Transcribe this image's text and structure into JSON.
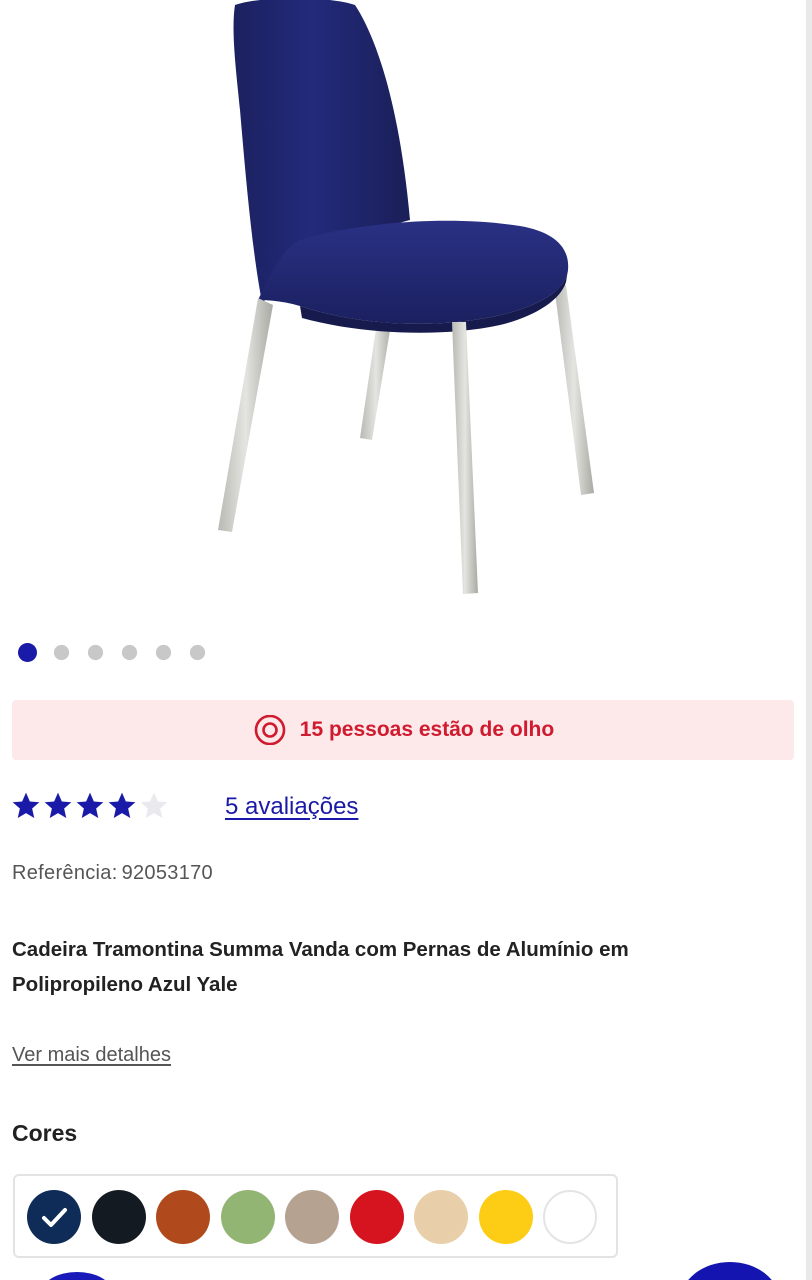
{
  "product": {
    "image_alt": "chair-photo",
    "carousel": {
      "total": 6,
      "active_index": 0
    },
    "watching_text": "15 pessoas estão de olho",
    "rating": {
      "value": 4,
      "max": 5,
      "reviews_label": "5 avaliações"
    },
    "reference_label": "Referência:",
    "reference_number": "92053170",
    "title": "Cadeira Tramontina Summa Vanda com Pernas de Alumínio em Polipropileno Azul Yale",
    "details_link": "Ver mais detalhes"
  },
  "colors": {
    "title": "Cores",
    "swatches": [
      {
        "color": "#0f2b57",
        "selected": true
      },
      {
        "color": "#141a22",
        "selected": false
      },
      {
        "color": "#b04a1c",
        "selected": false
      },
      {
        "color": "#93b574",
        "selected": false
      },
      {
        "color": "#b6a291",
        "selected": false
      },
      {
        "color": "#d5141f",
        "selected": false
      },
      {
        "color": "#e8cfa9",
        "selected": false
      },
      {
        "color": "#fccd14",
        "selected": false
      },
      {
        "color": "#ffffff",
        "selected": false
      }
    ]
  },
  "theme": {
    "accent": "#1a1aa8",
    "alert_text": "#d01a2e",
    "alert_bg": "#fde8ea"
  }
}
